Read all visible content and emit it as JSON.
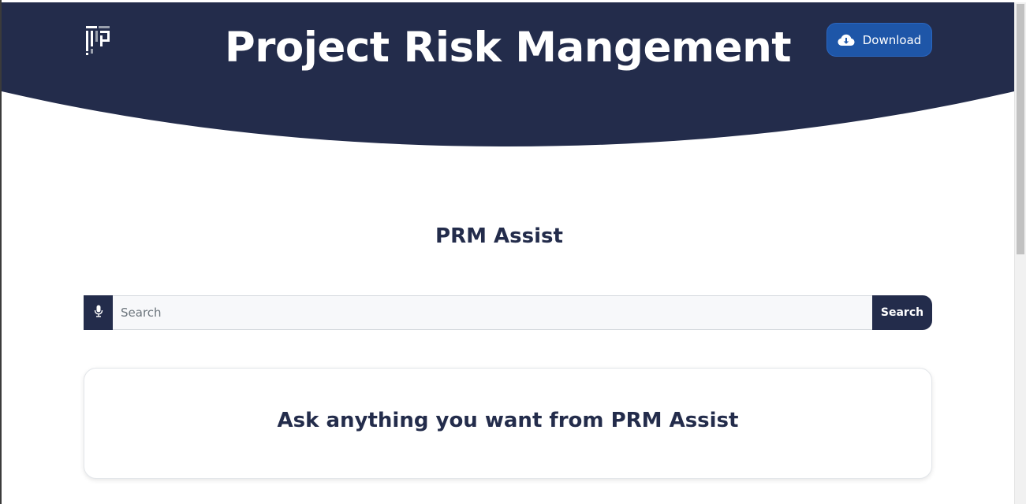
{
  "header": {
    "title": "Project Risk Mangement",
    "logo_icon": "prm-logo-icon",
    "download_label": "Download",
    "download_icon": "cloud-download-icon"
  },
  "assist": {
    "title": "PRM Assist"
  },
  "search": {
    "mic_icon": "microphone-icon",
    "placeholder": "Search",
    "value": "",
    "button_label": "Search"
  },
  "prompt_card": {
    "text": "Ask anything you want from PRM Assist"
  },
  "colors": {
    "header_bg": "#232c4b",
    "download_bg": "#1e56a8",
    "text_dark": "#232c4b",
    "search_bg": "#f7f8fa"
  }
}
